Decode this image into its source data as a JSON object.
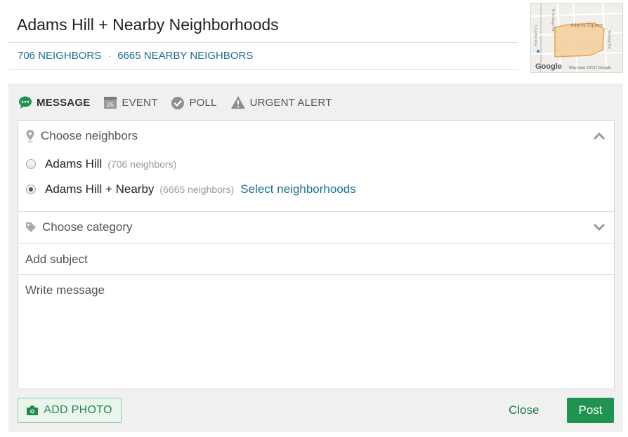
{
  "header": {
    "title": "Adams Hill + Nearby Neighborhoods",
    "neighbors_link": "706 NEIGHBORS",
    "separator": "·",
    "nearby_link": "6665 NEARBY NEIGHBORS"
  },
  "map": {
    "area_label": "Adams Square",
    "attribution": "Map data ©2017 Google",
    "logo": "Google",
    "street_labels": [
      "S Central Ave",
      "N Verdugo Rd",
      "Verdugo Rd"
    ]
  },
  "tabs": [
    {
      "label": "MESSAGE",
      "icon": "chat-bubble-icon",
      "active": true
    },
    {
      "label": "EVENT",
      "icon": "calendar-icon",
      "calendar_day": "26",
      "active": false
    },
    {
      "label": "POLL",
      "icon": "check-circle-icon",
      "active": false
    },
    {
      "label": "URGENT ALERT",
      "icon": "warning-icon",
      "active": false
    }
  ],
  "audience": {
    "heading": "Choose neighbors",
    "options": [
      {
        "name": "Adams Hill",
        "count": "(706 neighbors)",
        "selected": false
      },
      {
        "name": "Adams Hill + Nearby",
        "count": "(6665 neighbors)",
        "selected": true,
        "link": "Select neighborhoods"
      }
    ]
  },
  "category": {
    "heading": "Choose category"
  },
  "subject": {
    "placeholder": "Add subject"
  },
  "message": {
    "placeholder": "Write message"
  },
  "footer": {
    "add_photo": "ADD PHOTO",
    "close": "Close",
    "post": "Post"
  },
  "colors": {
    "accent_green": "#1f9450",
    "link_blue": "#1d6e93",
    "panel_gray": "#f0f0f0"
  }
}
